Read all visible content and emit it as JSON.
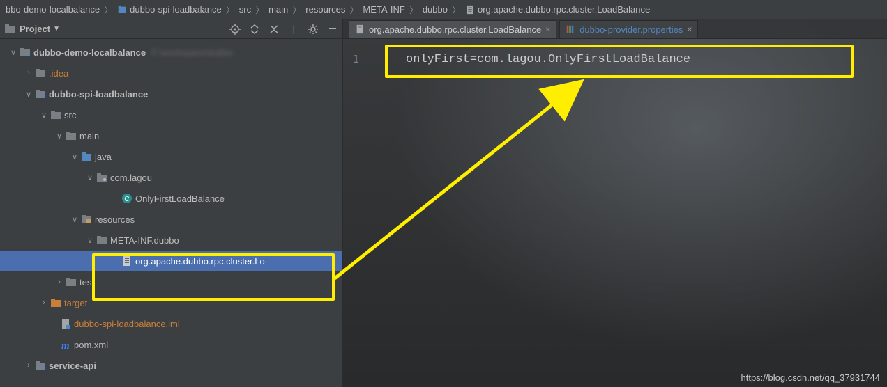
{
  "breadcrumbs": [
    "bbo-demo-localbalance",
    "dubbo-spi-loadbalance",
    "src",
    "main",
    "resources",
    "META-INF",
    "dubbo",
    "org.apache.dubbo.rpc.cluster.LoadBalance"
  ],
  "project_panel": {
    "title": "Project"
  },
  "tree": {
    "root": "dubbo-demo-localbalance",
    "idea": ".idea",
    "module": "dubbo-spi-loadbalance",
    "src": "src",
    "main": "main",
    "java": "java",
    "pkg": "com.lagou",
    "class": "OnlyFirstLoadBalance",
    "resources": "resources",
    "metainf": "META-INF.dubbo",
    "selected_file": "org.apache.dubbo.rpc.cluster.Lo",
    "test": "test",
    "target": "target",
    "iml": "dubbo-spi-loadbalance.iml",
    "pom": "pom.xml",
    "svc": "service-api"
  },
  "editor": {
    "tabs": [
      {
        "label": "org.apache.dubbo.rpc.cluster.LoadBalance",
        "active": true
      },
      {
        "label": "dubbo-provider.properties",
        "active": false
      }
    ],
    "line_no": "1",
    "code": "onlyFirst=com.lagou.OnlyFirstLoadBalance"
  },
  "watermark": "https://blog.csdn.net/qq_37931744"
}
